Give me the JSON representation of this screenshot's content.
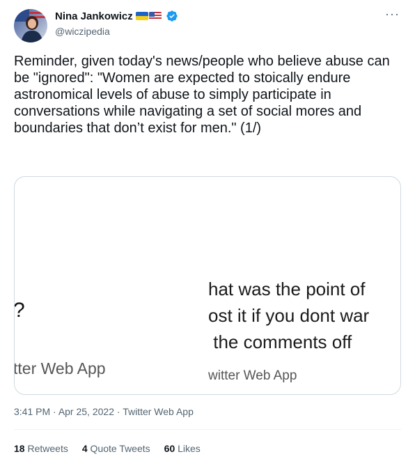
{
  "author": {
    "name": "Nina Jankowicz",
    "handle": "@wiczipedia",
    "badges": [
      "flag-ukraine-icon",
      "flag-usa-icon",
      "verified-badge-icon"
    ]
  },
  "tweet": {
    "text": "Reminder, given today's news/people who believe abuse can be \"ignored\": \"Women are expected to stoically endure astronomical levels of abuse to simply participate in conversations while navigating a set of social mores and boundaries that don’t exist for men.\" (1/)",
    "time": "3:41 PM",
    "date": "Apr 25, 2022",
    "source": "Twitter Web App"
  },
  "media": {
    "left": {
      "fragment": "?",
      "app_text": "tter Web App"
    },
    "right": {
      "lines": [
        "hat was the point of",
        "ost it if you dont war",
        " the comments off"
      ],
      "app_text": "witter Web App"
    }
  },
  "stats": {
    "retweets_count": "18",
    "retweets_label": "Retweets",
    "quote_count": "4",
    "quote_label": "Quote Tweets",
    "likes_count": "60",
    "likes_label": "Likes"
  },
  "colors": {
    "text": "#0f1419",
    "muted": "#536471",
    "border": "#cfd9de",
    "verified": "#1d9bf0"
  }
}
